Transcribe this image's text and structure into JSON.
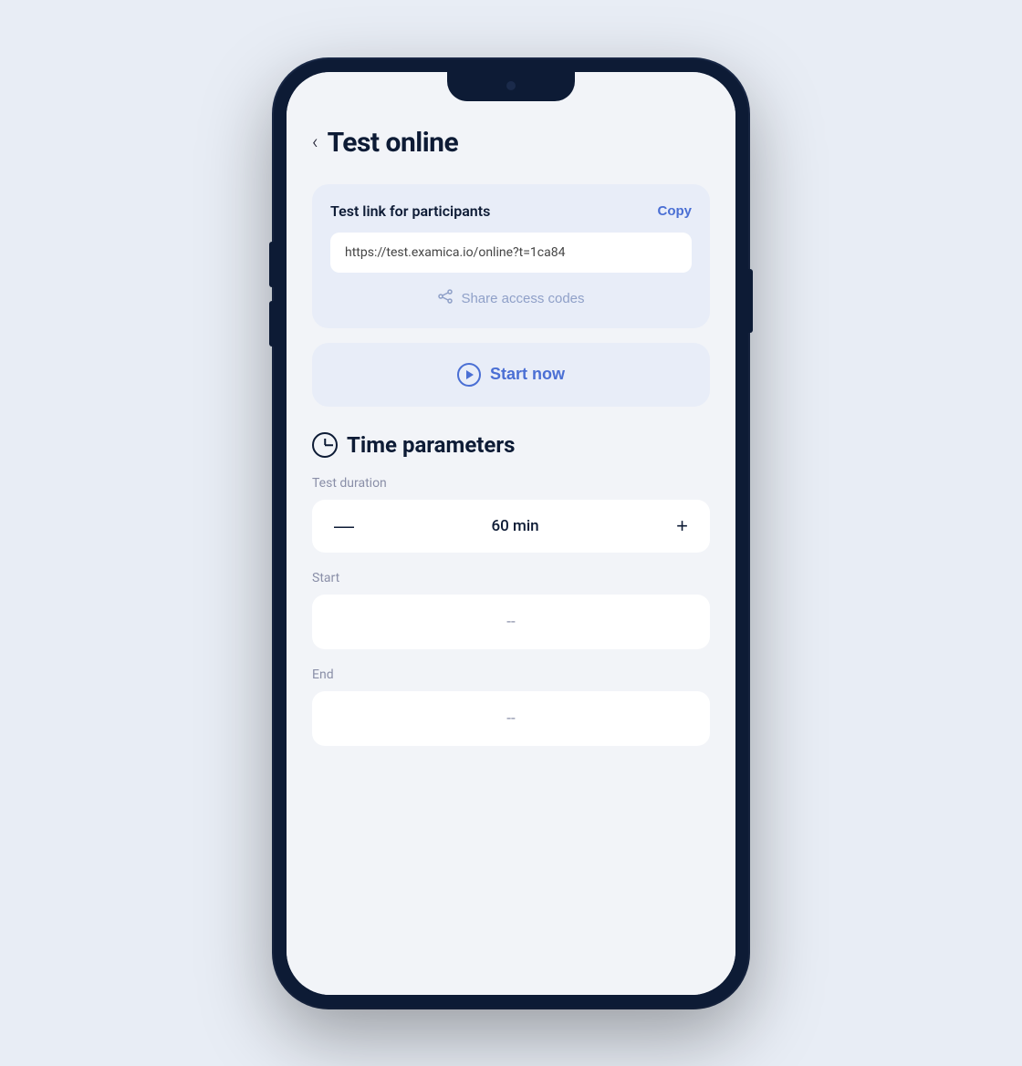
{
  "page": {
    "background_color": "#e8edf5"
  },
  "header": {
    "back_label": "‹",
    "title": "Test online"
  },
  "test_link_card": {
    "title": "Test link for participants",
    "copy_label": "Copy",
    "url_value": "https://test.examica.io/online?t=1ca84",
    "share_access_label": "Share access codes"
  },
  "start_now": {
    "label": "Start now"
  },
  "time_parameters": {
    "section_title": "Time parameters",
    "test_duration_label": "Test duration",
    "duration_value": "60 min",
    "minus_label": "—",
    "plus_label": "+",
    "start_label": "Start",
    "start_placeholder": "--",
    "end_label": "End",
    "end_placeholder": "--"
  }
}
